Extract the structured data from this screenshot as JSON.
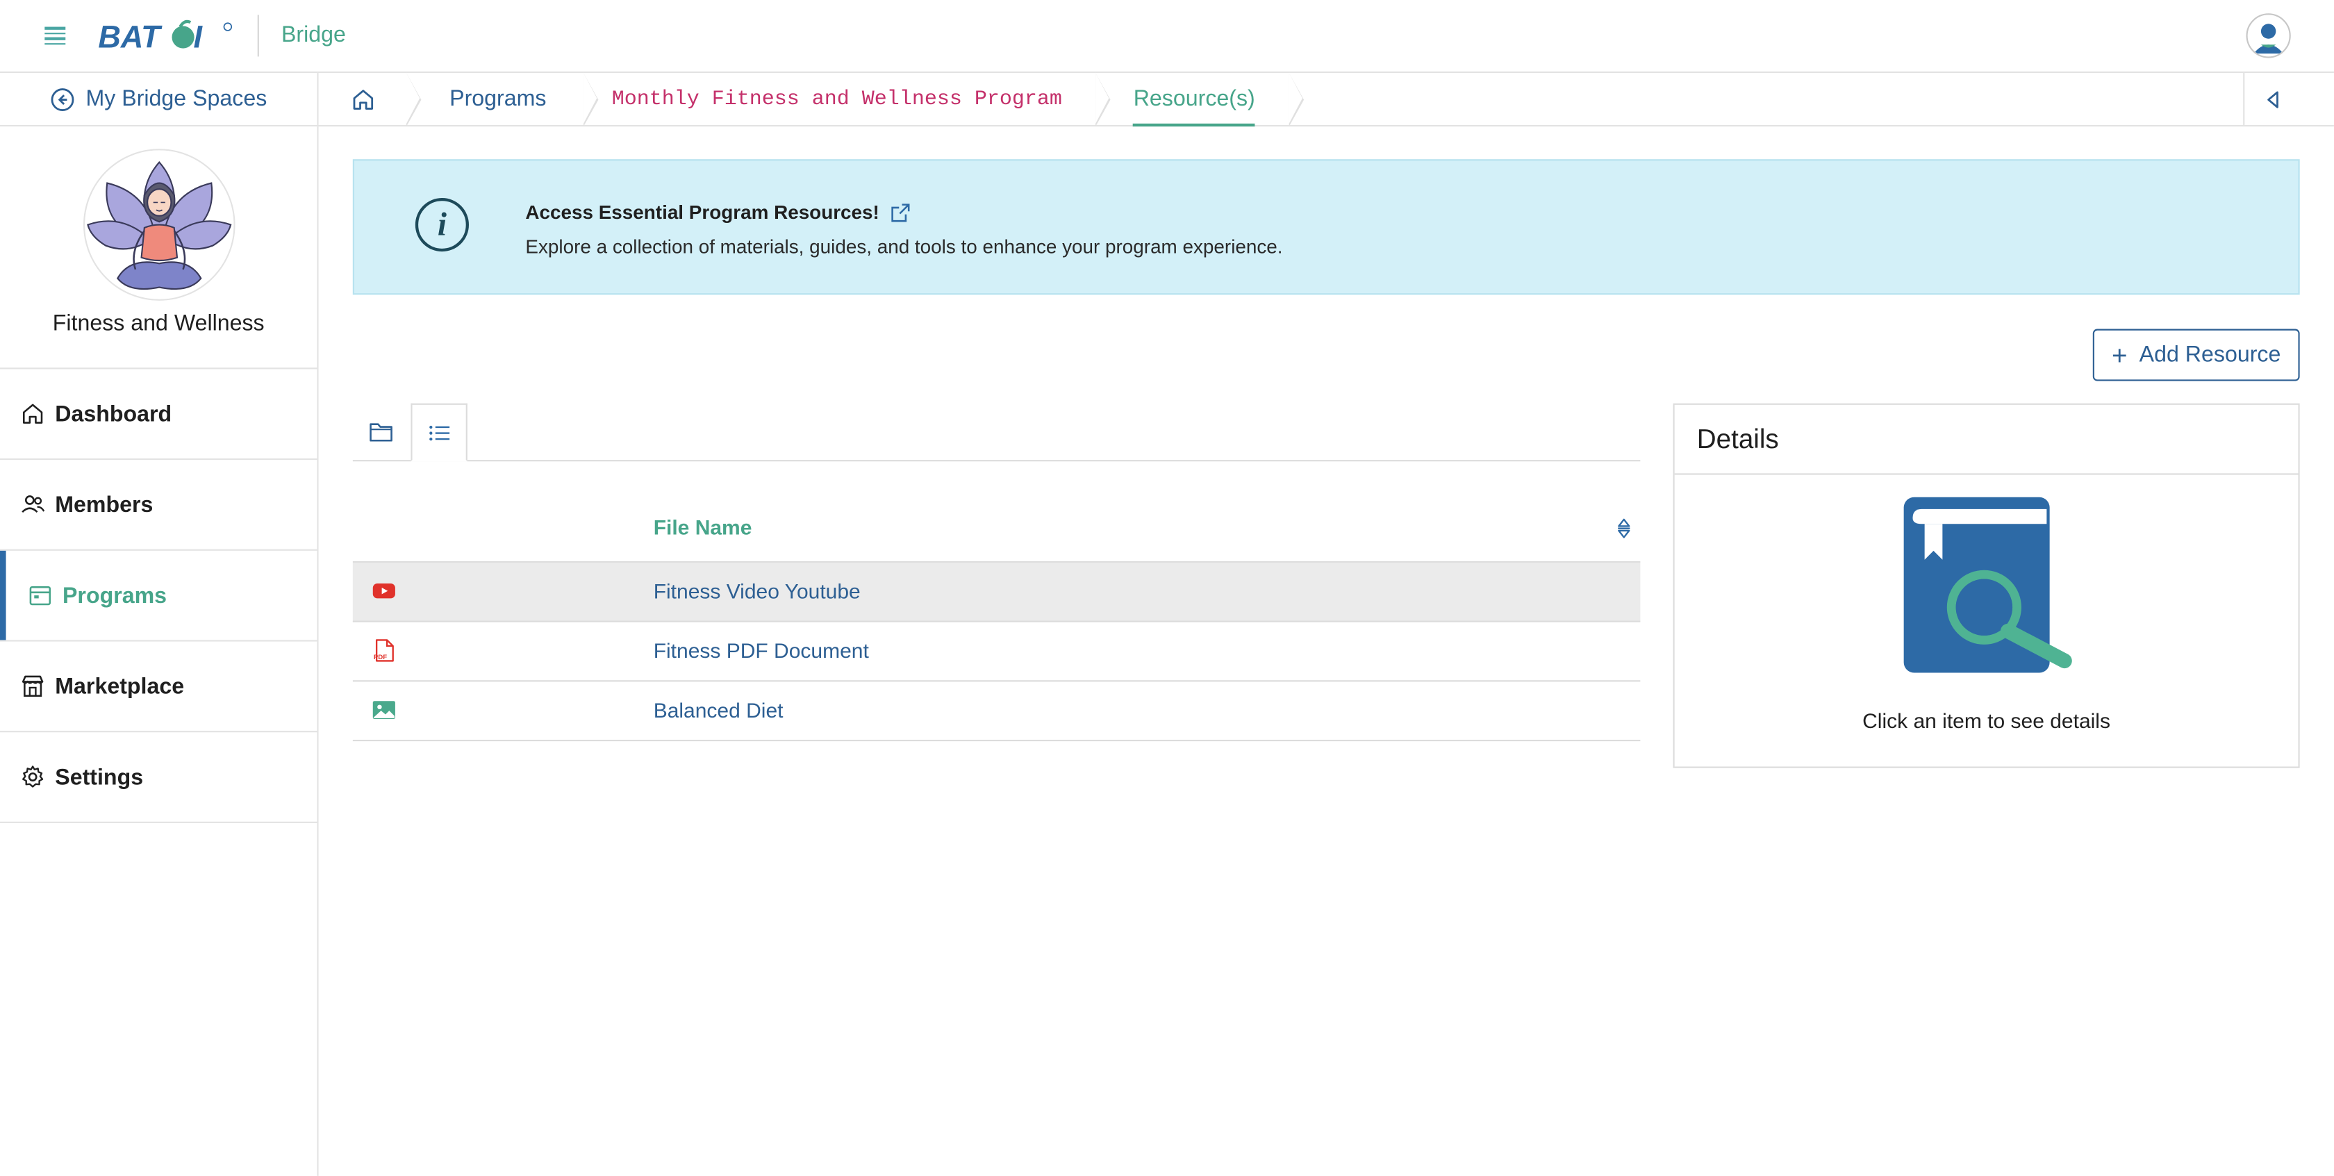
{
  "header": {
    "logo_text": "BATOI",
    "app_name": "Bridge"
  },
  "breadcrumb": {
    "back_label": "My Bridge Spaces",
    "items": [
      "Programs",
      "Monthly Fitness and Wellness Program",
      "Resource(s)"
    ]
  },
  "sidebar": {
    "space_name": "Fitness and Wellness",
    "items": [
      {
        "label": "Dashboard",
        "icon": "home-icon"
      },
      {
        "label": "Members",
        "icon": "users-icon"
      },
      {
        "label": "Programs",
        "icon": "calendar-icon",
        "active": true
      },
      {
        "label": "Marketplace",
        "icon": "store-icon"
      },
      {
        "label": "Settings",
        "icon": "gear-icon"
      }
    ]
  },
  "banner": {
    "title": "Access Essential Program Resources!",
    "description": "Explore a collection of materials, guides, and tools to enhance your program experience."
  },
  "toolbar": {
    "add_label": "Add Resource"
  },
  "table": {
    "column_header": "File Name",
    "rows": [
      {
        "name": "Fitness Video Youtube",
        "icon": "youtube-icon",
        "selected": true
      },
      {
        "name": "Fitness PDF Document",
        "icon": "pdf-icon"
      },
      {
        "name": "Balanced Diet",
        "icon": "image-icon"
      }
    ]
  },
  "details": {
    "title": "Details",
    "hint": "Click an item to see details"
  },
  "colors": {
    "brand_blue": "#2d6aa6",
    "accent_green": "#47a58a",
    "link_blue": "#2d5f93",
    "banner_bg": "#d3f0f8"
  }
}
